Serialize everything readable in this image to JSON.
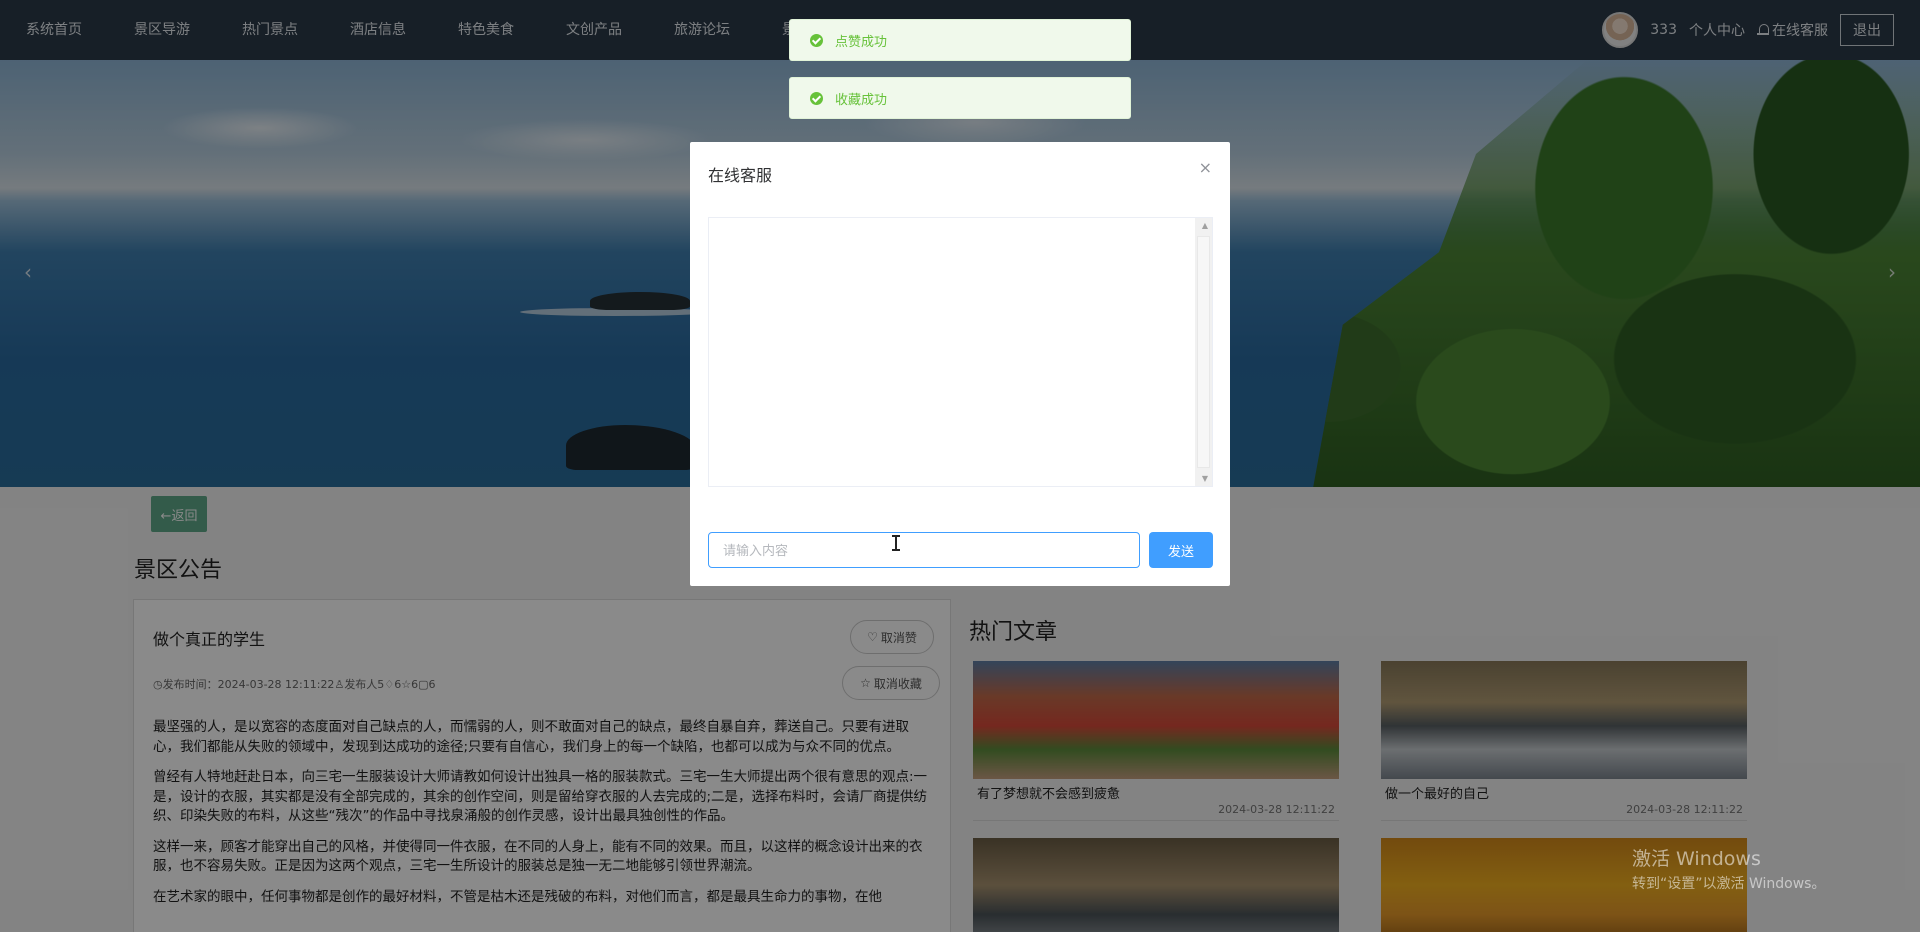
{
  "nav": {
    "items": [
      "系统首页",
      "景区导游",
      "热门景点",
      "酒店信息",
      "特色美食",
      "文创产品",
      "旅游论坛",
      "景区公告"
    ],
    "username": "333",
    "personal_center": "个人中心",
    "online_service": "在线客服",
    "logout": "退出"
  },
  "banner": {
    "prev": "‹",
    "next": "›"
  },
  "page": {
    "back_label": "←返回",
    "section_title": "景区公告",
    "article": {
      "title": "做个真正的学生",
      "like_toggle": "取消赞",
      "fav_toggle": "取消收藏",
      "meta": "发布时间：2024-03-28 12:11:22",
      "publisher": "发布人5",
      "likes": "6",
      "favorites": "6",
      "comments": "6",
      "paragraphs": [
        "最坚强的人，是以宽容的态度面对自己缺点的人，而懦弱的人，则不敢面对自己的缺点，最终自暴自弃，葬送自己。只要有进取心，我们都能从失败的领域中，发现到达成功的途径;只要有自信心，我们身上的每一个缺陷，也都可以成为与众不同的优点。",
        "曾经有人特地赶赴日本，向三宅一生服装设计大师请教如何设计出独具一格的服装款式。三宅一生大师提出两个很有意思的观点:一是，设计的衣服，其实都是没有全部完成的，其余的创作空间，则是留给穿衣服的人去完成的;二是，选择布料时，会请厂商提供纺织、印染失败的布料，从这些“残次”的作品中寻找泉涌般的创作灵感，设计出最具独创性的作品。",
        "这样一来，顾客才能穿出自己的风格，并使得同一件衣服，在不同的人身上，能有不同的效果。而且，以这样的概念设计出来的衣服，也不容易失败。正是因为这两个观点，三宅一生所设计的服装总是独一无二地能够引领世界潮流。",
        "在艺术家的眼中，任何事物都是创作的最好材料，不管是枯木还是残破的布料，对他们而言，都是最具生命力的事物，在他"
      ]
    },
    "hot": {
      "title": "热门文章",
      "items": [
        {
          "name": "有了梦想就不会感到疲惫",
          "date": "2024-03-28 12:11:22"
        },
        {
          "name": "做一个最好的自己",
          "date": "2024-03-28 12:11:22"
        },
        {
          "name": "",
          "date": ""
        },
        {
          "name": "",
          "date": ""
        }
      ]
    }
  },
  "toasts": [
    "点赞成功",
    "收藏成功"
  ],
  "dialog": {
    "title": "在线客服",
    "close": "×",
    "placeholder": "请输入内容",
    "input_value": "",
    "send": "发送"
  },
  "watermark": {
    "line1": "激活 Windows",
    "line2": "转到“设置”以激活 Windows。"
  },
  "colors": {
    "nav_bg": "#2c3a48",
    "accent": "#409eff",
    "success": "#67c23a",
    "back_btn": "#5fa889"
  }
}
